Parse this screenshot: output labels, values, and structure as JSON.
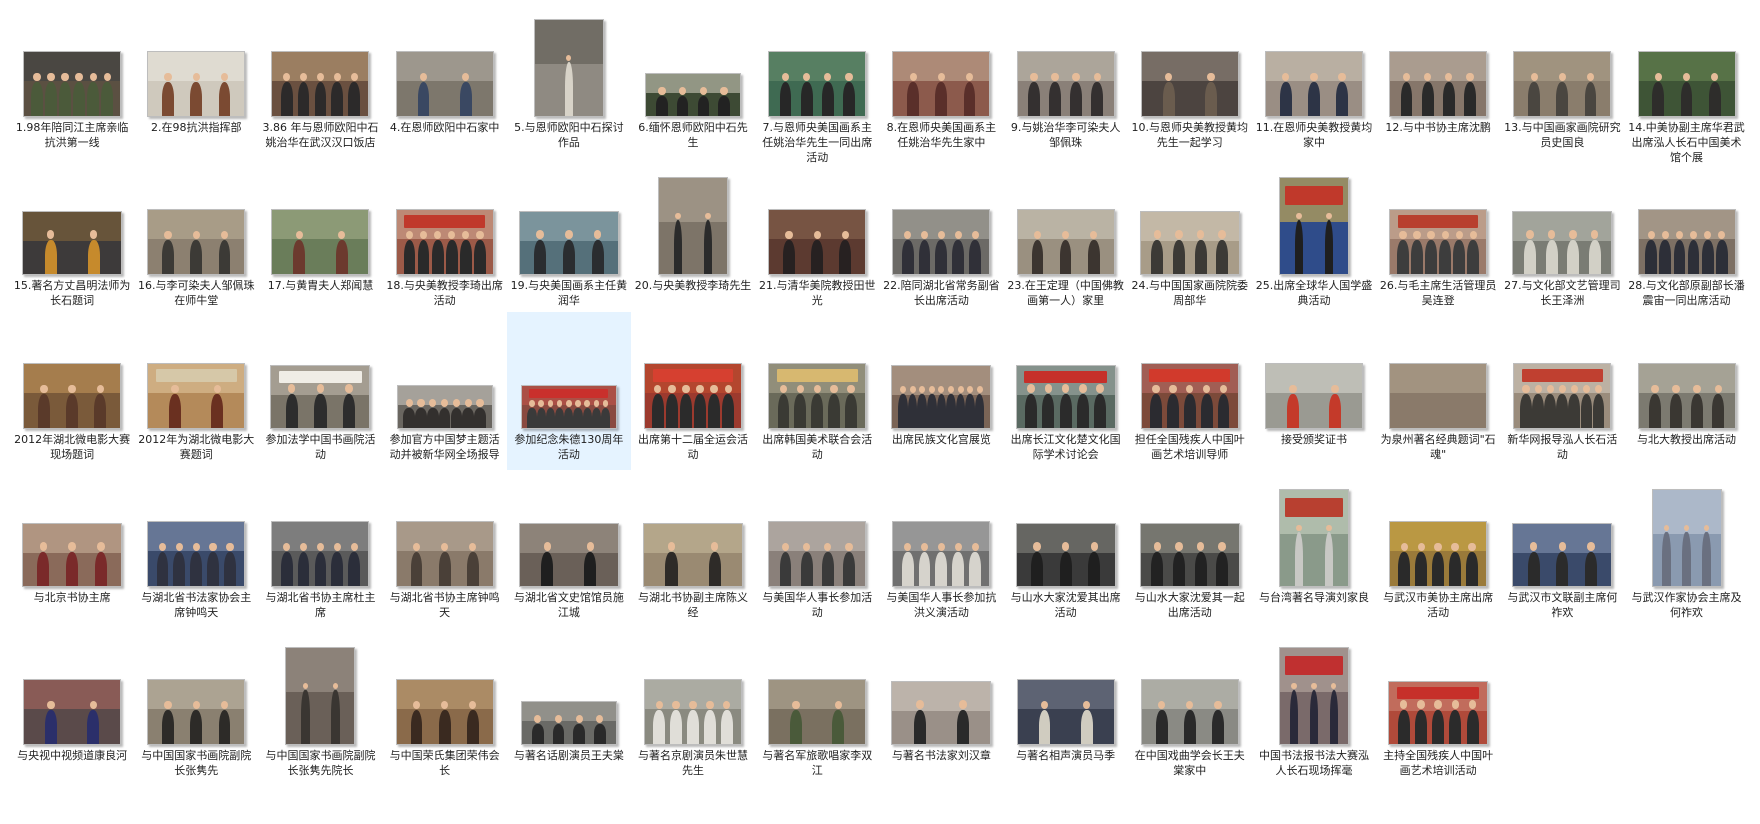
{
  "window": {
    "view": "large-icons"
  },
  "colors": {
    "selection": "#e5f3ff",
    "caption": "#1e1e1e",
    "background": "#ffffff"
  },
  "files": [
    {
      "name": "1.98年陪同江主席亲临抗洪第一线",
      "thumb": "l",
      "bg": "#5b5042",
      "wall": "#3d3f44",
      "banner": null,
      "people": 6,
      "dress": "#4b5a3a"
    },
    {
      "name": "2.在98抗洪指挥部",
      "thumb": "l",
      "bg": "#cfc9bd",
      "wall": "#ece9e2",
      "banner": null,
      "people": 3,
      "dress": "#7b4a32"
    },
    {
      "name": "3.86 年与恩师欧阳中石姚治华在武汉汉口饭店",
      "thumb": "l",
      "bg": "#6a5040",
      "wall": "#c2a47c",
      "banner": null,
      "people": 5,
      "dress": "#2c2a2a"
    },
    {
      "name": "4.在恩师欧阳中石家中",
      "thumb": "l",
      "bg": "#7d776c",
      "wall": "#b8b3aa",
      "banner": null,
      "people": 2,
      "dress": "#3a4862"
    },
    {
      "name": "5.与恩师欧阳中石探讨作品",
      "thumb": "p",
      "bg": "#8f8a82",
      "wall": "#5a564f",
      "banner": null,
      "people": 1,
      "dress": "#d8d3c8"
    },
    {
      "name": "6.缅怀恩师欧阳中石先生",
      "thumb": "s",
      "bg": "#3d4a34",
      "wall": "#d9d6c6",
      "banner": null,
      "people": 4,
      "dress": "#222"
    },
    {
      "name": "7.与恩师央美国画系主任姚治华先生一同出席活动",
      "thumb": "l",
      "bg": "#3f6a52",
      "wall": "#6b8f70",
      "banner": null,
      "people": 4,
      "dress": "#272727"
    },
    {
      "name": "8.在恩师央美国画系主任姚治华先生家中",
      "thumb": "l",
      "bg": "#8c5a4c",
      "wall": "#c9b39b",
      "banner": null,
      "people": 3,
      "dress": "#5a2f2a"
    },
    {
      "name": "9.与姚治华李可染夫人邹佩珠",
      "thumb": "l",
      "bg": "#8a8078",
      "wall": "#c8c2b6",
      "banner": null,
      "people": 4,
      "dress": "#343030"
    },
    {
      "name": "10.与恩师央美教授黄均先生一起学习",
      "thumb": "l",
      "bg": "#4c4440",
      "wall": "#9b8f84",
      "banner": null,
      "people": 2,
      "dress": "#6a5c4e"
    },
    {
      "name": "11.在恩师央美教授黄均家中",
      "thumb": "l",
      "bg": "#9a8e84",
      "wall": "#d4cabb",
      "banner": null,
      "people": 3,
      "dress": "#2d3446"
    },
    {
      "name": "12.与中书协主席沈鹏",
      "thumb": "l",
      "bg": "#86766a",
      "wall": "#c9bcad",
      "banner": null,
      "people": 4,
      "dress": "#2a2a2a"
    },
    {
      "name": "13.与中国画家画院研究员史国良",
      "thumb": "l",
      "bg": "#8a7d6c",
      "wall": "#b3a58f",
      "banner": null,
      "people": 3,
      "dress": "#4a4640"
    },
    {
      "name": "14.中美协副主席华君武出席泓人长石中国美术馆个展",
      "thumb": "l",
      "bg": "#3e5436",
      "wall": "#6b8a56",
      "banner": null,
      "people": 3,
      "dress": "#2e2d2b"
    },
    {
      "name": "15.著名方丈昌明法师为长石题词",
      "thumb": "w",
      "bg": "#3d3a3a",
      "wall": "#8a6a3a",
      "banner": null,
      "people": 2,
      "dress": "#c68a2c"
    },
    {
      "name": "16.与李可染夫人邹佩珠在师牛堂",
      "thumb": "l",
      "bg": "#8c8070",
      "wall": "#c0b39b",
      "banner": null,
      "people": 3,
      "dress": "#3c3a36"
    },
    {
      "name": "17.与黄胄夫人郑闻慧",
      "thumb": "l",
      "bg": "#6a7d5a",
      "wall": "#a8b38e",
      "banner": null,
      "people": 2,
      "dress": "#6c3a2e"
    },
    {
      "name": "18.与央美教授李琦出席活动",
      "thumb": "l",
      "bg": "#9c5a48",
      "wall": "#d9b19a",
      "banner": "#c0392b",
      "people": 6,
      "dress": "#2a2a2a"
    },
    {
      "name": "19.与央美国画系主任黄润华",
      "thumb": "w",
      "bg": "#55707a",
      "wall": "#9bb3b8",
      "banner": null,
      "people": 3,
      "dress": "#2a2d30"
    },
    {
      "name": "20.与央美教授李琦先生",
      "thumb": "p",
      "bg": "#7d7468",
      "wall": "#b6ab9b",
      "banner": null,
      "people": 2,
      "dress": "#2b2b2b"
    },
    {
      "name": "21.与清华美院教授田世光",
      "thumb": "l",
      "bg": "#5c3a30",
      "wall": "#8e6a54",
      "banner": null,
      "people": 3,
      "dress": "#272121"
    },
    {
      "name": "22.陪同湖北省常务副省长出席活动",
      "thumb": "l",
      "bg": "#6c6a66",
      "wall": "#b2aea6",
      "banner": null,
      "people": 5,
      "dress": "#303038"
    },
    {
      "name": "23.在王定理（中国佛教画第一人）家里",
      "thumb": "l",
      "bg": "#9a9080",
      "wall": "#d6cfc1",
      "banner": null,
      "people": 3,
      "dress": "#3c3530"
    },
    {
      "name": "24.与中国国家画院院委周部华",
      "thumb": "w",
      "bg": "#a89c88",
      "wall": "#d8d0c0",
      "banner": null,
      "people": 4,
      "dress": "#3c3a36"
    },
    {
      "name": "25.出席全球华人国学盛典活动",
      "thumb": "p",
      "bg": "#2f4c8a",
      "wall": "#e7c045",
      "banner": "#c0392b",
      "people": 2,
      "dress": "#1f1f1f"
    },
    {
      "name": "26.与毛主席生活管理员吴连登",
      "thumb": "l",
      "bg": "#9a7a6a",
      "wall": "#d7b8a3",
      "banner": "#b8402e",
      "people": 6,
      "dress": "#3d3d3d"
    },
    {
      "name": "27.与文化部文艺管理司长王泽洲",
      "thumb": "w",
      "bg": "#7a7c74",
      "wall": "#c3c5bb",
      "banner": null,
      "people": 4,
      "dress": "#d2d0c6"
    },
    {
      "name": "28.与文化部原副部长潘震宙一同出席活动",
      "thumb": "l",
      "bg": "#7d7064",
      "wall": "#c1b4a2",
      "banner": null,
      "people": 6,
      "dress": "#2d2f38"
    },
    {
      "name": "2012年湖北微电影大赛现场题词",
      "thumb": "l",
      "bg": "#7a5a3a",
      "wall": "#c99a5c",
      "banner": null,
      "people": 3,
      "dress": "#5a3a2a"
    },
    {
      "name": "2012年为湖北微电影大赛题词",
      "thumb": "l",
      "bg": "#b48a5a",
      "wall": "#e3cba3",
      "banner": "#d6c8a8",
      "people": 2,
      "dress": "#6a3020"
    },
    {
      "name": "参加法学中国书画院活动",
      "thumb": "w",
      "bg": "#7a7468",
      "wall": "#c6c0b2",
      "banner": "#f0ede6",
      "people": 3,
      "dress": "#2d2d2d"
    },
    {
      "name": "参加官方中国梦主题活动并被新华网全场报导",
      "thumb": "s",
      "bg": "#6a6660",
      "wall": "#d6d2ca",
      "banner": null,
      "people": 7,
      "dress": "#33302e"
    },
    {
      "name": "参加纪念朱德130周年活动",
      "thumb": "s",
      "bg": "#8a4a40",
      "wall": "#c6564a",
      "banner": "#c9302c",
      "people": 9,
      "dress": "#3a3a3a",
      "selected": true
    },
    {
      "name": "出席第十二届全运会活动",
      "thumb": "l",
      "bg": "#9c3a2e",
      "wall": "#c9502f",
      "banner": "#d64030",
      "people": 6,
      "dress": "#2b2b2b"
    },
    {
      "name": "出席韩国美术联合会活动",
      "thumb": "l",
      "bg": "#6a6a5a",
      "wall": "#b0ac96",
      "banner": "#d7b870",
      "people": 5,
      "dress": "#3a3a34"
    },
    {
      "name": "出席民族文化宫展览",
      "thumb": "w",
      "bg": "#7a6456",
      "wall": "#c4b09e",
      "banner": null,
      "people": 9,
      "dress": "#2f3038"
    },
    {
      "name": "出席长江文化楚文化国际学术讨论会",
      "thumb": "w",
      "bg": "#5a6a62",
      "wall": "#a9b3ae",
      "banner": "#c6302a",
      "people": 5,
      "dress": "#2b2b2b"
    },
    {
      "name": "担任全国残疾人中国叶画艺术培训导师",
      "thumb": "l",
      "bg": "#7c4a3a",
      "wall": "#c0706a",
      "banner": "#d13a2c",
      "people": 5,
      "dress": "#2b2b30"
    },
    {
      "name": "接受颁奖证书",
      "thumb": "l",
      "bg": "#9a9a92",
      "wall": "#dcdcd4",
      "banner": null,
      "people": 2,
      "dress": "#c43a2a"
    },
    {
      "name": "为泉州著名经典题词\"石魂\"",
      "thumb": "l",
      "bg": "#8a7a6a",
      "wall": "#b7a792",
      "banner": null,
      "people": 0,
      "dress": "#6a6050"
    },
    {
      "name": "新华网报导泓人长石活动",
      "thumb": "l",
      "bg": "#9a8c7c",
      "wall": "#d9d0c2",
      "banner": "#c04030",
      "people": 7,
      "dress": "#3c3a36"
    },
    {
      "name": "与北大教授出席活动",
      "thumb": "l",
      "bg": "#7c7a70",
      "wall": "#c7c3b5",
      "banner": null,
      "people": 4,
      "dress": "#3a3732"
    },
    {
      "name": "与北京书协主席",
      "thumb": "w",
      "bg": "#8a6a5a",
      "wall": "#d0b8a2",
      "banner": null,
      "people": 3,
      "dress": "#7a2a2a"
    },
    {
      "name": "与湖北省书法家协会主席钟鸣天",
      "thumb": "l",
      "bg": "#3a4a6a",
      "wall": "#8a9ab8",
      "banner": null,
      "people": 5,
      "dress": "#2f3240"
    },
    {
      "name": "与湖北省书协主席杜主席",
      "thumb": "l",
      "bg": "#5a5a5a",
      "wall": "#9b9b9b",
      "banner": null,
      "people": 5,
      "dress": "#2b2e3a"
    },
    {
      "name": "与湖北省书协主席钟鸣天",
      "thumb": "l",
      "bg": "#8a7a6a",
      "wall": "#c1b3a2",
      "banner": null,
      "people": 3,
      "dress": "#4a4038"
    },
    {
      "name": "与湖北省文史馆馆员施江城",
      "thumb": "w",
      "bg": "#6a6058",
      "wall": "#aaa096",
      "banner": null,
      "people": 2,
      "dress": "#1f1f1f"
    },
    {
      "name": "与湖北书协副主席陈义经",
      "thumb": "w",
      "bg": "#9a8a72",
      "wall": "#cbbd9e",
      "banner": null,
      "people": 2,
      "dress": "#2e2b28"
    },
    {
      "name": "与美国华人事长参加活动",
      "thumb": "l",
      "bg": "#8a807a",
      "wall": "#c9c1bb",
      "banner": null,
      "people": 4,
      "dress": "#3a3a3a"
    },
    {
      "name": "与美国华人事长参加抗洪义演活动",
      "thumb": "l",
      "bg": "#707070",
      "wall": "#b6b6b6",
      "banner": null,
      "people": 5,
      "dress": "#d6d3cc"
    },
    {
      "name": "与山水大家沈爱其出席活动",
      "thumb": "w",
      "bg": "#3a3a3a",
      "wall": "#8a8a84",
      "banner": null,
      "people": 3,
      "dress": "#1f1f1f"
    },
    {
      "name": "与山水大家沈爱其一起出席活动",
      "thumb": "w",
      "bg": "#4a4a48",
      "wall": "#9a9a90",
      "banner": null,
      "people": 4,
      "dress": "#222"
    },
    {
      "name": "与台湾著名导演刘家良",
      "thumb": "p",
      "bg": "#8a9a8a",
      "wall": "#cdd8c6",
      "banner": "#b84030",
      "people": 2,
      "dress": "#c8c8c4"
    },
    {
      "name": "与武汉市美协主席出席活动",
      "thumb": "l",
      "bg": "#9a7a3a",
      "wall": "#d6b04a",
      "banner": null,
      "people": 5,
      "dress": "#2a2a2a"
    },
    {
      "name": "与武汉市文联副主席何祚欢",
      "thumb": "w",
      "bg": "#3a4a6a",
      "wall": "#8a9ab8",
      "banner": null,
      "people": 3,
      "dress": "#2b2b2b"
    },
    {
      "name": "与武汉作家协会主席及何祚欢",
      "thumb": "p",
      "bg": "#8a9ab0",
      "wall": "#c9d2de",
      "banner": null,
      "people": 3,
      "dress": "#6a7080"
    },
    {
      "name": "与央视中视频道康良河",
      "thumb": "l",
      "bg": "#5a4a4a",
      "wall": "#b06a60",
      "banner": null,
      "people": 2,
      "dress": "#2b2f6a"
    },
    {
      "name": "与中国国家书画院副院长张隽先",
      "thumb": "l",
      "bg": "#8a8070",
      "wall": "#c8bfae",
      "banner": null,
      "people": 3,
      "dress": "#2d2b28"
    },
    {
      "name": "与中国国家书画院副院长张隽先院长",
      "thumb": "p",
      "bg": "#6a6058",
      "wall": "#a89f96",
      "banner": null,
      "people": 2,
      "dress": "#3a3632"
    },
    {
      "name": "与中国荣氏集团荣伟会长",
      "thumb": "l",
      "bg": "#8a6a4a",
      "wall": "#c7a57c",
      "banner": null,
      "people": 3,
      "dress": "#3a2a20"
    },
    {
      "name": "与著名话剧演员王夫棠",
      "thumb": "s",
      "bg": "#6a6a66",
      "wall": "#b0aea8",
      "banner": null,
      "people": 4,
      "dress": "#2a2a2a"
    },
    {
      "name": "与著名京剧演员朱世慧先生",
      "thumb": "l",
      "bg": "#8a8a80",
      "wall": "#c7c7bd",
      "banner": null,
      "people": 5,
      "dress": "#e0ded8"
    },
    {
      "name": "与著名军旅歌唱家李双江",
      "thumb": "l",
      "bg": "#7a7060",
      "wall": "#bcb29e",
      "banner": null,
      "people": 2,
      "dress": "#4a5a3a"
    },
    {
      "name": "与著名书法家刘汉章",
      "thumb": "w",
      "bg": "#9a9088",
      "wall": "#d8d0c6",
      "banner": null,
      "people": 2,
      "dress": "#2a2a2a"
    },
    {
      "name": "与著名相声演员马季",
      "thumb": "l",
      "bg": "#3a4050",
      "wall": "#7a8090",
      "banner": null,
      "people": 2,
      "dress": "#d0ccc0"
    },
    {
      "name": "在中国戏曲学会长王夫棠家中",
      "thumb": "l",
      "bg": "#8a8a84",
      "wall": "#c8c8c0",
      "banner": null,
      "people": 3,
      "dress": "#2a2a2a"
    },
    {
      "name": "中国书法报书法大赛泓人长石现场挥毫",
      "thumb": "p",
      "bg": "#7a6a6a",
      "wall": "#c0b0a8",
      "banner": "#c03030",
      "people": 3,
      "dress": "#2a2a3a"
    },
    {
      "name": "主持全国残疾人中国叶画艺术培训活动",
      "thumb": "w",
      "bg": "#b04a3a",
      "wall": "#d08878",
      "banner": "#c6302a",
      "people": 5,
      "dress": "#2b2b2b"
    }
  ]
}
